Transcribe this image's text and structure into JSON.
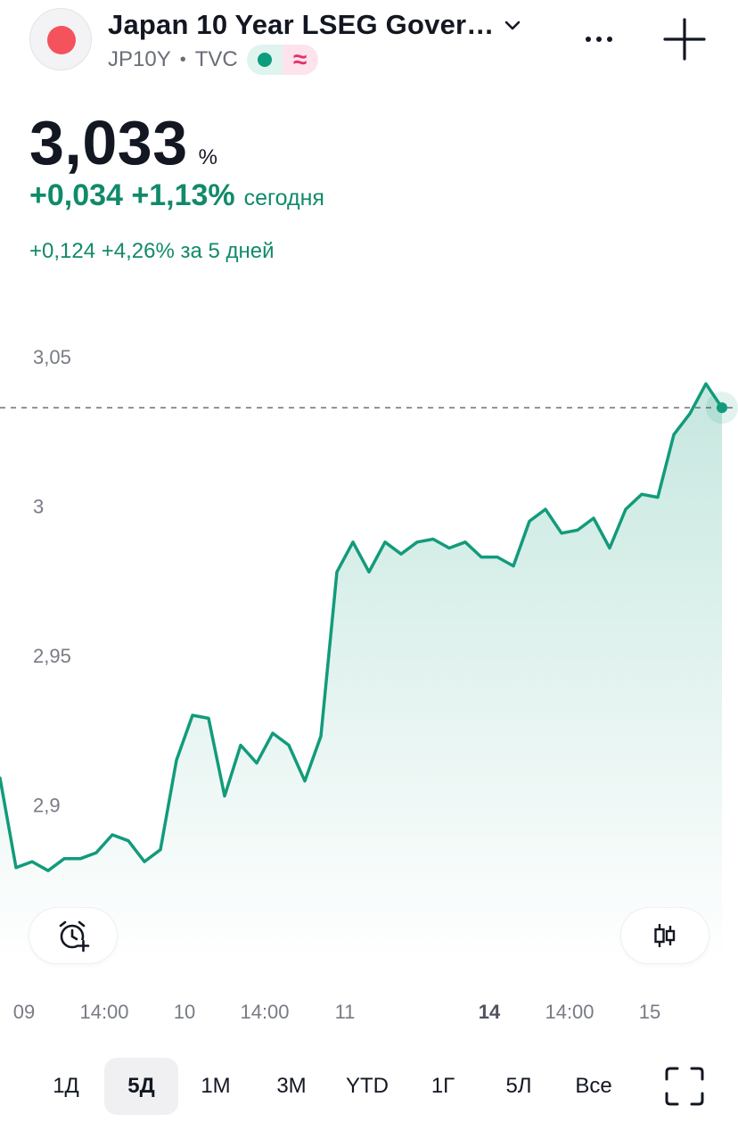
{
  "header": {
    "title": "Japan 10 Year LSEG Gover…",
    "ticker": "JP10Y",
    "exchange": "TVC",
    "flag_icon": "japan-flag-icon",
    "market_status_color": "#0d9c7d",
    "delayed_icon": "≈",
    "delayed_color": "#e0326e"
  },
  "quote": {
    "price": "3,033",
    "unit": "%",
    "change_today": "+0,034 +1,13%",
    "today_label": "сегодня",
    "change_5d": "+0,124 +4,26% за 5 дней",
    "positive_color": "#118a6a"
  },
  "chart_data": {
    "type": "area",
    "range": "5Д",
    "y_axis": {
      "ylim": [
        2.847,
        3.062
      ],
      "ticks": [
        3.05,
        3.0,
        2.95,
        2.9
      ],
      "tick_labels": [
        "3,05",
        "3",
        "2,95",
        "2,9"
      ]
    },
    "x_axis": {
      "tick_labels": [
        {
          "label": "09",
          "x": 1.5,
          "bold": false
        },
        {
          "label": "14:00",
          "x": 6.5,
          "bold": false
        },
        {
          "label": "10",
          "x": 11.5,
          "bold": false
        },
        {
          "label": "14:00",
          "x": 16.5,
          "bold": false
        },
        {
          "label": "11",
          "x": 21.5,
          "bold": false
        },
        {
          "label": "14",
          "x": 30.5,
          "bold": true
        },
        {
          "label": "14:00",
          "x": 35.5,
          "bold": false
        },
        {
          "label": "15",
          "x": 40.5,
          "bold": false
        }
      ]
    },
    "last_value": 3.033,
    "line_color": "#129b7b",
    "values": [
      2.909,
      2.879,
      2.881,
      2.878,
      2.882,
      2.882,
      2.884,
      2.89,
      2.888,
      2.881,
      2.885,
      2.915,
      2.93,
      2.929,
      2.903,
      2.92,
      2.914,
      2.924,
      2.92,
      2.908,
      2.923,
      2.978,
      2.988,
      2.978,
      2.988,
      2.984,
      2.988,
      2.989,
      2.986,
      2.988,
      2.983,
      2.983,
      2.98,
      2.995,
      2.999,
      2.991,
      2.992,
      2.996,
      2.986,
      2.999,
      3.004,
      3.003,
      3.024,
      3.031,
      3.041,
      3.033
    ]
  },
  "controls": {
    "alert_icon": "alarm-plus-icon",
    "chart_style_icon": "candlestick-icon",
    "fullscreen_icon": "fullscreen-icon"
  },
  "ranges": [
    "1Д",
    "5Д",
    "1М",
    "3М",
    "YTD",
    "1Г",
    "5Л",
    "Все"
  ],
  "active_range": "5Д"
}
